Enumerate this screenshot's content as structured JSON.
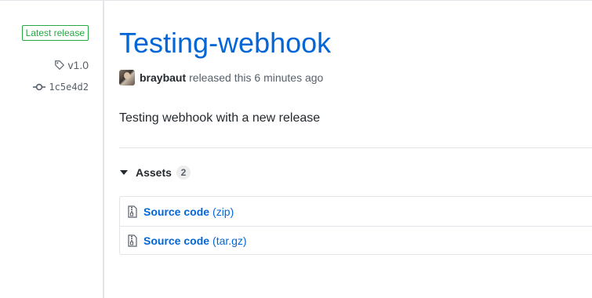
{
  "sidebar": {
    "latest_badge": "Latest release",
    "tag": "v1.0",
    "commit": "1c5e4d2",
    "tag_icon": "tag-icon",
    "commit_icon": "git-commit-icon"
  },
  "release": {
    "title": "Testing-webhook",
    "author": "braybaut",
    "released_text": "released this 6 minutes ago",
    "body": "Testing webhook with a new release"
  },
  "assets": {
    "label": "Assets",
    "count": "2",
    "items": [
      {
        "name": "Source code",
        "ext": "(zip)",
        "icon": "file-zip-icon"
      },
      {
        "name": "Source code",
        "ext": "(tar.gz)",
        "icon": "file-zip-icon"
      }
    ]
  },
  "colors": {
    "link": "#0366d6",
    "badge_green": "#28a745",
    "muted": "#586069",
    "border": "#e1e4e8"
  }
}
